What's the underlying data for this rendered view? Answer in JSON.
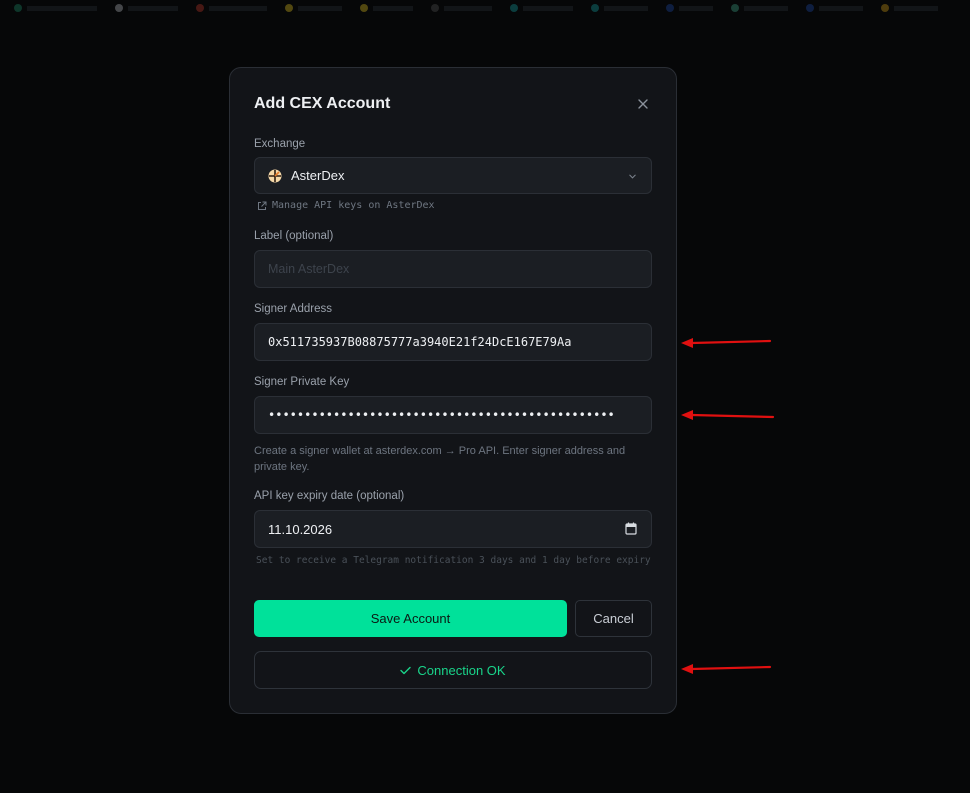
{
  "modal": {
    "title": "Add CEX Account"
  },
  "exchange": {
    "label": "Exchange",
    "selected": "AsterDex",
    "manage_link": "Manage API keys on AsterDex"
  },
  "label_field": {
    "label": "Label (optional)",
    "placeholder": "Main AsterDex",
    "value": ""
  },
  "signer_address": {
    "label": "Signer Address",
    "value": "0x511735937B08875777a3940E21f24DcE167E79Aa"
  },
  "signer_private_key": {
    "label": "Signer Private Key",
    "masked_value": "••••••••••••••••••••••••••••••••••••••••••••••••"
  },
  "help_text": "Create a signer wallet at asterdex.com → Pro API. Enter signer address and private key.",
  "expiry": {
    "label": "API key expiry date (optional)",
    "value": "11.10.2026",
    "hint": "Set to receive a Telegram notification 3 days and 1 day before expiry"
  },
  "buttons": {
    "save": "Save Account",
    "cancel": "Cancel",
    "connection_status": "Connection OK"
  },
  "colors": {
    "accent": "#00e19a",
    "success_text": "#19d48a",
    "annotation_arrow": "#e01010",
    "modal_bg": "#121418",
    "page_bg": "#060708"
  },
  "icons": {
    "close": "close-icon",
    "exchange_logo": "asterdex-logo-icon",
    "dropdown": "chevron-down-icon",
    "external_link": "external-link-icon",
    "calendar": "calendar-icon",
    "success": "check-icon"
  }
}
